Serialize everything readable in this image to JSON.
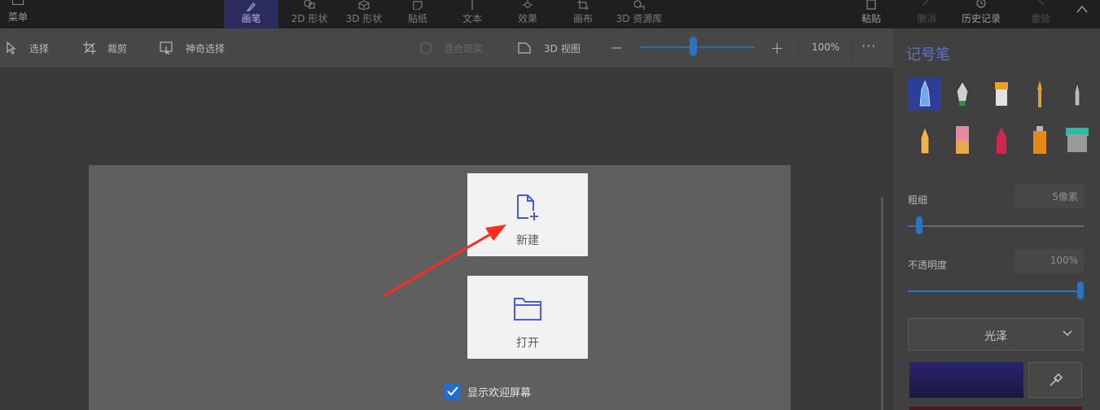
{
  "ribbon": {
    "menu_label": "菜单",
    "tabs": [
      {
        "label": "画笔",
        "icon": "brush-icon"
      },
      {
        "label": "2D 形状",
        "icon": "shapes-2d-icon"
      },
      {
        "label": "3D 形状",
        "icon": "cube-icon"
      },
      {
        "label": "贴纸",
        "icon": "sticker-icon"
      },
      {
        "label": "文本",
        "icon": "text-icon"
      },
      {
        "label": "效果",
        "icon": "effects-icon"
      },
      {
        "label": "画布",
        "icon": "canvas-icon"
      },
      {
        "label": "3D 资源库",
        "icon": "library-3d-icon"
      }
    ],
    "paste_label": "粘贴",
    "undo_label": "撤消",
    "history_label": "历史记录",
    "redo_label": "重做"
  },
  "toolbar": {
    "select_label": "选择",
    "crop_label": "裁剪",
    "magic_select_label": "神奇选择",
    "mixed_reality_label": "混合现实",
    "view_3d_label": "3D 视图",
    "zoom_minus": "—",
    "zoom_plus": "+",
    "zoom_level": "100%",
    "zoom_fraction": 0.46,
    "more_label": "···"
  },
  "welcome": {
    "new_label": "新建",
    "open_label": "打开",
    "show_welcome_label": "显示欢迎屏幕",
    "show_welcome_checked": true
  },
  "panel": {
    "title": "记号笔",
    "brushes": [
      "marker-icon",
      "calligraphy-pen-icon",
      "oil-brush-icon",
      "watercolor-icon",
      "pixel-pen-icon",
      "pencil-icon",
      "eraser-icon",
      "crayon-icon",
      "spray-can-icon",
      "fill-icon"
    ],
    "thickness_label": "粗细",
    "thickness_value": "5像素",
    "thickness_fraction": 0.05,
    "opacity_label": "不透明度",
    "opacity_value": "100%",
    "opacity_fraction": 1.0,
    "finish_value": "光泽",
    "colors": {
      "accent": "#2a72c4",
      "title": "#5b74d3",
      "swatch": "#2a2470"
    }
  }
}
